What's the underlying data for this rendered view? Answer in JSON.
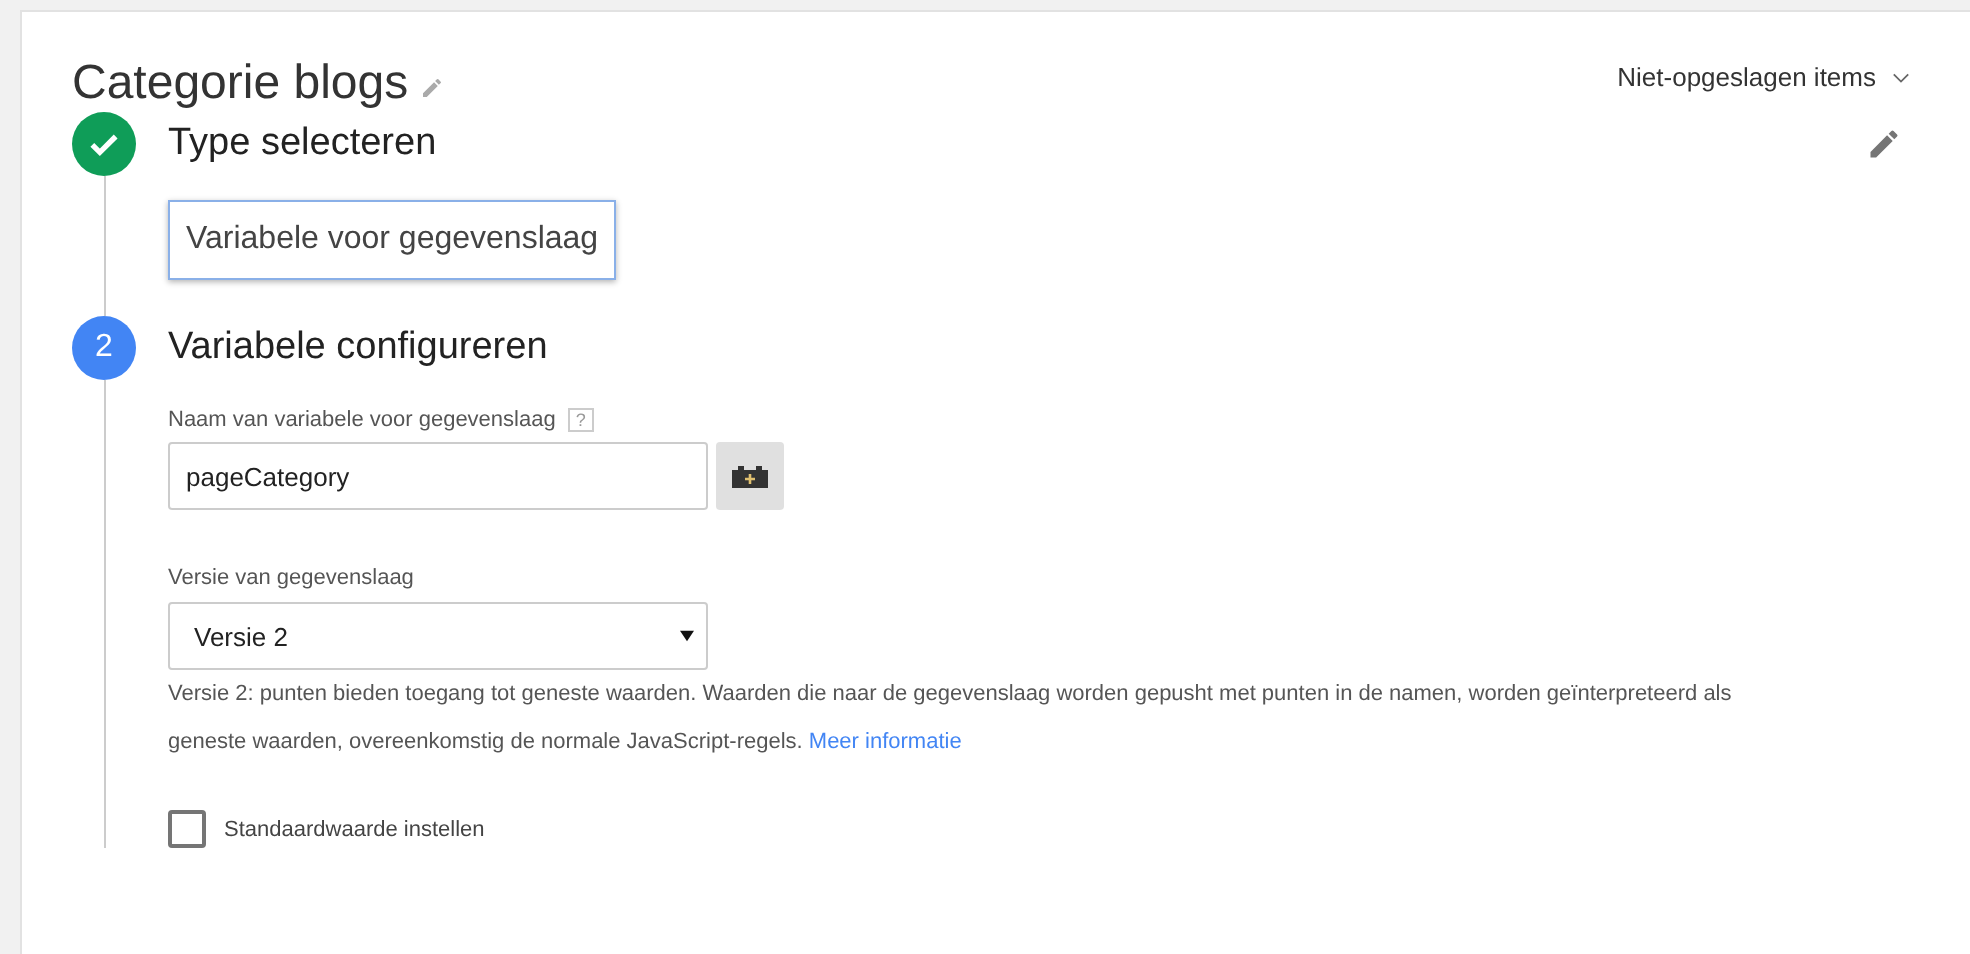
{
  "title": "Categorie blogs",
  "unsaved_menu": {
    "label": "Niet-opgeslagen items"
  },
  "steps": [
    {
      "completed": true,
      "title": "Type selecteren",
      "selection": "Variabele voor gegevenslaag"
    },
    {
      "completed": false,
      "number": "2",
      "title": "Variabele configureren"
    }
  ],
  "name_field": {
    "label": "Naam van variabele voor gegevenslaag",
    "help": "?",
    "value": "pageCategory"
  },
  "version_select": {
    "label": "Versie van gegevenslaag",
    "value": "Versie 2"
  },
  "help_text": "Versie 2: punten bieden toegang tot geneste waarden. Waarden die naar de gegevenslaag worden gepusht met punten in de namen, worden geïnterpreteerd als geneste waarden, overeenkomstig de normale JavaScript-regels.",
  "help_link": "Meer informatie",
  "default_checkbox": {
    "label": "Standaardwaarde instellen",
    "checked": false
  }
}
